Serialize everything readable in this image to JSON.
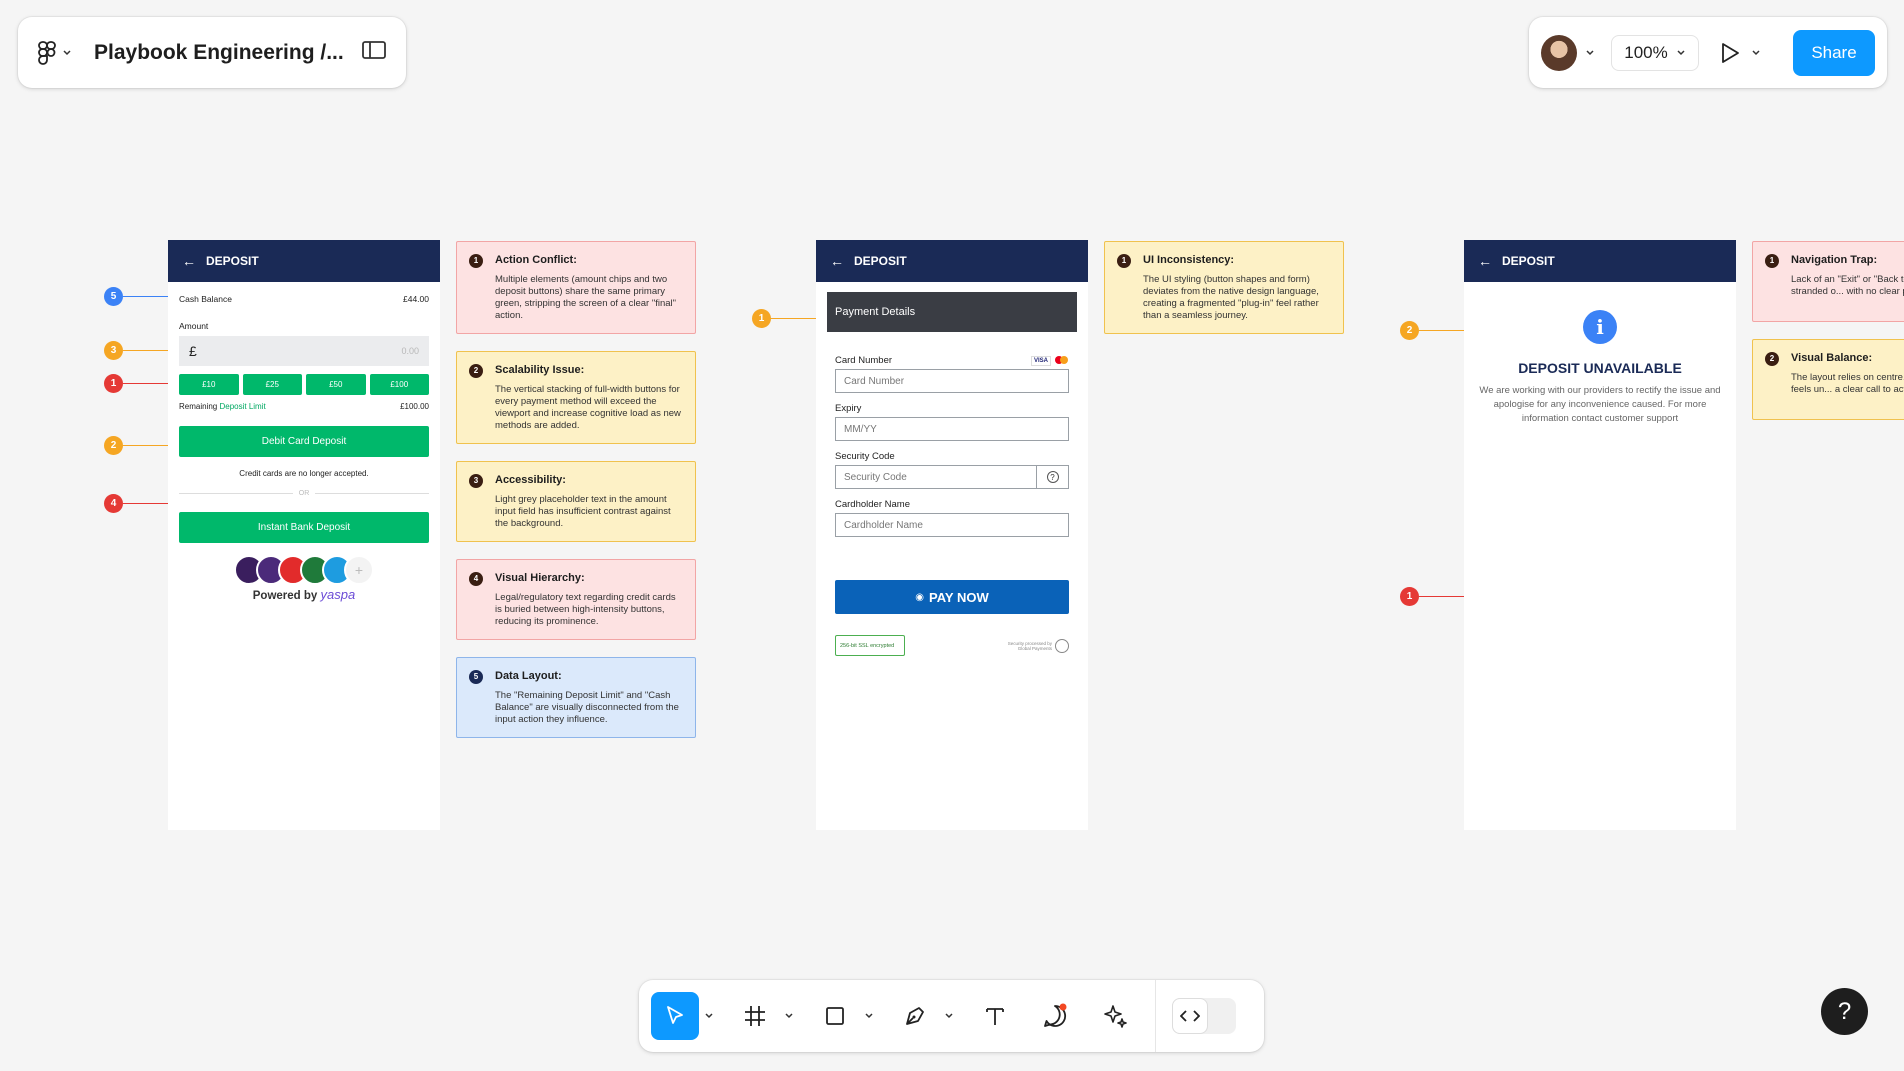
{
  "app": {
    "title": "Playbook Engineering /...",
    "zoom": "100%",
    "share_label": "Share"
  },
  "screen1": {
    "header": "DEPOSIT",
    "cash_balance_label": "Cash Balance",
    "cash_balance_value": "£44.00",
    "amount_label": "Amount",
    "currency": "£",
    "amount_placeholder": "0.00",
    "chips": [
      "£10",
      "£25",
      "£50",
      "£100"
    ],
    "remaining_label": "Remaining",
    "deposit_limit_link": "Deposit Limit",
    "remaining_value": "£100.00",
    "debit_button": "Debit Card Deposit",
    "credit_note": "Credit cards are no longer accepted.",
    "or_label": "OR",
    "bank_button": "Instant Bank Deposit",
    "powered_by": "Powered by",
    "powered_brand": "yaspa"
  },
  "screen1_markers": [
    "5",
    "3",
    "1",
    "2",
    "4"
  ],
  "screen1_notes": [
    {
      "num": "1",
      "title": "Action Conflict:",
      "body": "Multiple elements (amount chips and two deposit buttons) share the same primary green, stripping the screen of a clear \"final\" action."
    },
    {
      "num": "2",
      "title": "Scalability Issue:",
      "body": "The vertical stacking of full-width buttons for every payment method will exceed the viewport and increase cognitive load as new methods are added."
    },
    {
      "num": "3",
      "title": "Accessibility:",
      "body": "Light grey placeholder text in the amount input field has insufficient contrast against the background."
    },
    {
      "num": "4",
      "title": "Visual Hierarchy:",
      "body": "Legal/regulatory text regarding credit cards is buried between high-intensity buttons, reducing its prominence."
    },
    {
      "num": "5",
      "title": "Data Layout:",
      "body": "The \"Remaining Deposit Limit\" and \"Cash Balance\" are visually disconnected from the input action they influence."
    }
  ],
  "screen2": {
    "header": "DEPOSIT",
    "section_title": "Payment Details",
    "card_number_label": "Card Number",
    "card_number_placeholder": "Card Number",
    "card_brands": [
      "VISA",
      "MC"
    ],
    "expiry_label": "Expiry",
    "expiry_placeholder": "MM/YY",
    "security_label": "Security Code",
    "security_placeholder": "Security Code",
    "help_glyph": "?",
    "holder_label": "Cardholder Name",
    "holder_placeholder": "Cardholder Name",
    "pay_button": "PAY NOW",
    "ssl_badge": "256-bit SSL encrypted",
    "secured_by": "Security processed by Global Payments"
  },
  "screen2_markers": [
    "1"
  ],
  "screen2_notes": [
    {
      "num": "1",
      "title": "UI Inconsistency:",
      "body": "The UI styling (button shapes and form) deviates from the native design language, creating a fragmented \"plug-in\" feel rather than a seamless journey."
    }
  ],
  "screen3": {
    "header": "DEPOSIT",
    "info_glyph": "i",
    "title": "DEPOSIT UNAVAILABLE",
    "message": "We are working with our providers to rectify the issue and apologise for any inconvenience caused. For more information contact customer support"
  },
  "screen3_markers": [
    "2",
    "1"
  ],
  "screen3_notes": [
    {
      "num": "1",
      "title": "Navigation Trap:",
      "body": "Lack of an \"Exit\" or \"Back to ... leaves the user stranded o... with no clear path back to ..."
    },
    {
      "num": "2",
      "title": "Visual Balance:",
      "body": "The layout relies on centre... empty field, which feels un... a clear call to action."
    }
  ],
  "help_label": "?",
  "colors": {
    "header": "#1a2a56",
    "green": "#00b86b",
    "pay_blue": "#0a62b8",
    "share": "#0d99ff",
    "marker_red": "#e53935",
    "marker_orange": "#f5a623",
    "marker_blue": "#3b82f6"
  }
}
